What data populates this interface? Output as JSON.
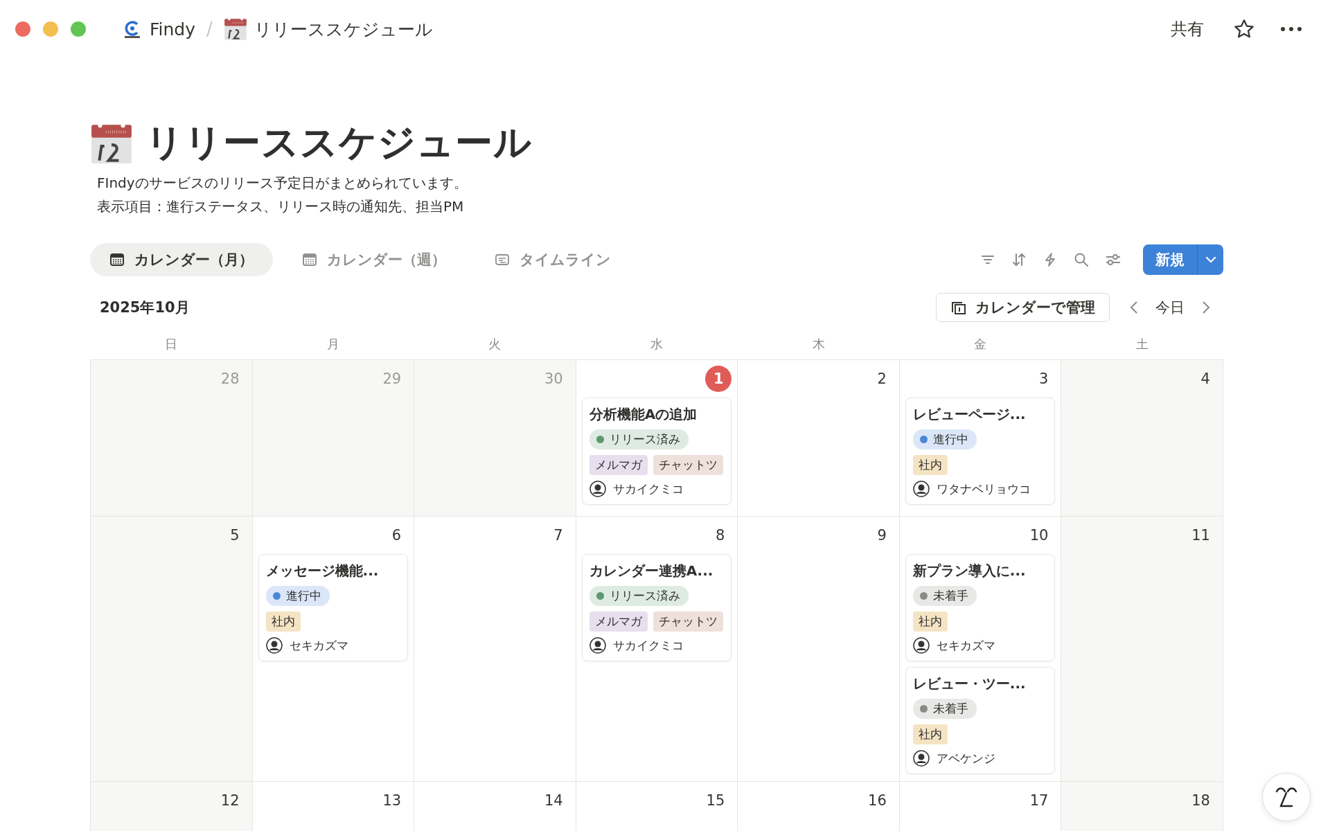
{
  "window": {
    "breadcrumb": [
      {
        "kind": "logo",
        "label": "Findy"
      },
      {
        "kind": "calendar",
        "label": "リリーススケジュール"
      }
    ],
    "separator": "/",
    "share": "共有"
  },
  "page": {
    "title": "リリーススケジュール",
    "description": [
      "FIndyのサービスのリリース予定日がまとめられています。",
      "表示項目：進行ステータス、リリース時の通知先、担当PM"
    ]
  },
  "views": [
    {
      "kind": "calendar",
      "label": "カレンダー（月）",
      "selected": true
    },
    {
      "kind": "calendar",
      "label": "カレンダー（週）",
      "selected": false
    },
    {
      "kind": "timeline",
      "label": "タイムライン",
      "selected": false
    }
  ],
  "toolbar": {
    "new_button": "新規"
  },
  "calendar": {
    "month": "2025年10月",
    "manage_button": "カレンダーで管理",
    "today_button": "今日",
    "weekdays": [
      "日",
      "月",
      "火",
      "水",
      "木",
      "金",
      "土"
    ],
    "weeks": [
      [
        {
          "day": "28",
          "outside_month": true,
          "today": false
        },
        {
          "day": "29",
          "outside_month": true,
          "today": false
        },
        {
          "day": "30",
          "outside_month": true,
          "today": false
        },
        {
          "day": "1",
          "outside_month": false,
          "today": true,
          "events": [
            {
              "title": "分析機能Aの追加",
              "status": {
                "label": "リリース済み",
                "color": "#5b9a6f"
              },
              "tags": [
                {
                  "label": "メルマガ",
                  "color": "#e8deee"
                },
                {
                  "label": "チャットツ",
                  "color": "#eee0da"
                }
              ],
              "assignee": "サカイクミコ"
            }
          ]
        },
        {
          "day": "2",
          "outside_month": false,
          "today": false
        },
        {
          "day": "3",
          "outside_month": false,
          "today": false,
          "events": [
            {
              "title": "レビューページ...",
              "status": {
                "label": "進行中",
                "color": "#4a87db"
              },
              "tags": [
                {
                  "label": "社内",
                  "color": "#f5e4c4"
                }
              ],
              "assignee": "ワタナベリョウコ"
            }
          ]
        },
        {
          "day": "4",
          "outside_month": false,
          "today": false
        }
      ],
      [
        {
          "day": "5",
          "outside_month": false,
          "today": false
        },
        {
          "day": "6",
          "outside_month": false,
          "today": false,
          "events": [
            {
              "title": "メッセージ機能...",
              "status": {
                "label": "進行中",
                "color": "#4a87db"
              },
              "tags": [
                {
                  "label": "社内",
                  "color": "#f5e4c4"
                }
              ],
              "assignee": "セキカズマ"
            }
          ]
        },
        {
          "day": "7",
          "outside_month": false,
          "today": false
        },
        {
          "day": "8",
          "outside_month": false,
          "today": false,
          "events": [
            {
              "title": "カレンダー連携A...",
              "status": {
                "label": "リリース済み",
                "color": "#5b9a6f"
              },
              "tags": [
                {
                  "label": "メルマガ",
                  "color": "#e8deee"
                },
                {
                  "label": "チャットツ",
                  "color": "#eee0da"
                }
              ],
              "assignee": "サカイクミコ"
            }
          ]
        },
        {
          "day": "9",
          "outside_month": false,
          "today": false
        },
        {
          "day": "10",
          "outside_month": false,
          "today": false,
          "events": [
            {
              "title": "新プラン導入に...",
              "status": {
                "label": "未着手",
                "color": "#8d8a85"
              },
              "tags": [
                {
                  "label": "社内",
                  "color": "#f5e4c4"
                }
              ],
              "assignee": "セキカズマ"
            },
            {
              "title": "レビュー・ツー...",
              "status": {
                "label": "未着手",
                "color": "#8d8a85"
              },
              "tags": [
                {
                  "label": "社内",
                  "color": "#f5e4c4"
                }
              ],
              "assignee": "アベケンジ"
            }
          ]
        },
        {
          "day": "11",
          "outside_month": false,
          "today": false
        }
      ],
      [
        {
          "day": "12",
          "outside_month": false,
          "today": false
        },
        {
          "day": "13",
          "outside_month": false,
          "today": false
        },
        {
          "day": "14",
          "outside_month": false,
          "today": false
        },
        {
          "day": "15",
          "outside_month": false,
          "today": false
        },
        {
          "day": "16",
          "outside_month": false,
          "today": false
        },
        {
          "day": "17",
          "outside_month": false,
          "today": false
        },
        {
          "day": "18",
          "outside_month": false,
          "today": false
        }
      ]
    ]
  }
}
